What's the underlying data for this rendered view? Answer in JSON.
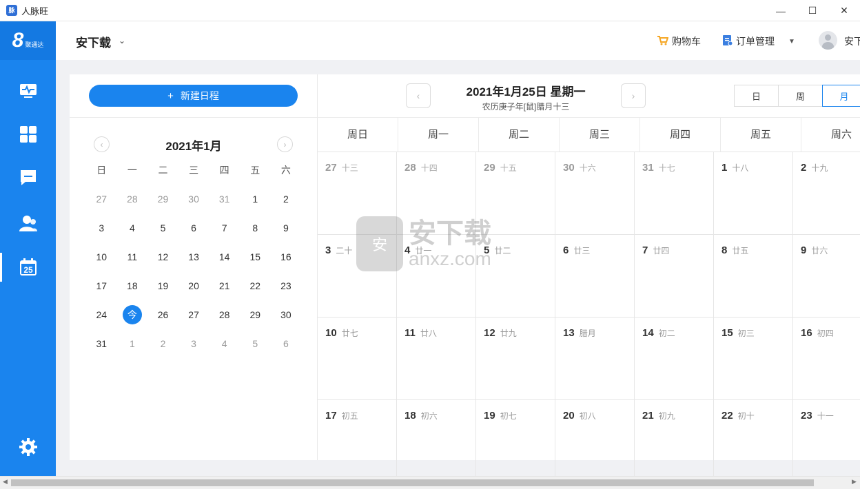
{
  "window": {
    "title": "人脉旺",
    "minimize": "—",
    "maximize": "☐",
    "close": "✕"
  },
  "logo": {
    "mark": "8",
    "text": "聚通达"
  },
  "header": {
    "user": "安下载",
    "cart": "购物车",
    "orders": "订单管理",
    "account": "安下载"
  },
  "sidebar": {
    "items": [
      {
        "name": "dashboard",
        "icon": "monitor-icon"
      },
      {
        "name": "apps",
        "icon": "grid-icon"
      },
      {
        "name": "messages",
        "icon": "chat-icon"
      },
      {
        "name": "contacts",
        "icon": "users-icon"
      },
      {
        "name": "calendar",
        "icon": "calendar-icon",
        "badge": "25",
        "active": true
      }
    ],
    "settings_icon": "gear-icon"
  },
  "left": {
    "new_button": "新建日程",
    "plus": "+",
    "mini_title": "2021年1月",
    "weekday_heads": [
      "日",
      "一",
      "二",
      "三",
      "四",
      "五",
      "六"
    ],
    "weeks": [
      [
        [
          "27",
          1
        ],
        [
          "28",
          1
        ],
        [
          "29",
          1
        ],
        [
          "30",
          1
        ],
        [
          "31",
          1
        ],
        [
          "1",
          0
        ],
        [
          "2",
          0
        ]
      ],
      [
        [
          "3",
          0
        ],
        [
          "4",
          0
        ],
        [
          "5",
          0
        ],
        [
          "6",
          0
        ],
        [
          "7",
          0
        ],
        [
          "8",
          0
        ],
        [
          "9",
          0
        ]
      ],
      [
        [
          "10",
          0
        ],
        [
          "11",
          0
        ],
        [
          "12",
          0
        ],
        [
          "13",
          0
        ],
        [
          "14",
          0
        ],
        [
          "15",
          0
        ],
        [
          "16",
          0
        ]
      ],
      [
        [
          "17",
          0
        ],
        [
          "18",
          0
        ],
        [
          "19",
          0
        ],
        [
          "20",
          0
        ],
        [
          "21",
          0
        ],
        [
          "22",
          0
        ],
        [
          "23",
          0
        ]
      ],
      [
        [
          "24",
          0
        ],
        [
          "今",
          2
        ],
        [
          "26",
          0
        ],
        [
          "27",
          0
        ],
        [
          "28",
          0
        ],
        [
          "29",
          0
        ],
        [
          "30",
          0
        ]
      ],
      [
        [
          "31",
          0
        ],
        [
          "1",
          1
        ],
        [
          "2",
          1
        ],
        [
          "3",
          1
        ],
        [
          "4",
          1
        ],
        [
          "5",
          1
        ],
        [
          "6",
          1
        ]
      ]
    ]
  },
  "right": {
    "date_title": "2021年1月25日 星期一",
    "lunar": "农历庚子年[鼠]腊月十三",
    "views": [
      "日",
      "周",
      "月"
    ],
    "active_view": "月",
    "week_heads": [
      "周日",
      "周一",
      "周二",
      "周三",
      "周四",
      "周五",
      "周六"
    ],
    "rows": [
      [
        [
          "27",
          "十三",
          1
        ],
        [
          "28",
          "十四",
          1
        ],
        [
          "29",
          "十五",
          1
        ],
        [
          "30",
          "十六",
          1
        ],
        [
          "31",
          "十七",
          1
        ],
        [
          "1",
          "十八",
          0
        ],
        [
          "2",
          "十九",
          0
        ]
      ],
      [
        [
          "3",
          "二十",
          0
        ],
        [
          "4",
          "廿一",
          0
        ],
        [
          "5",
          "廿二",
          0
        ],
        [
          "6",
          "廿三",
          0
        ],
        [
          "7",
          "廿四",
          0
        ],
        [
          "8",
          "廿五",
          0
        ],
        [
          "9",
          "廿六",
          0
        ]
      ],
      [
        [
          "10",
          "廿七",
          0
        ],
        [
          "11",
          "廿八",
          0
        ],
        [
          "12",
          "廿九",
          0
        ],
        [
          "13",
          "腊月",
          0
        ],
        [
          "14",
          "初二",
          0
        ],
        [
          "15",
          "初三",
          0
        ],
        [
          "16",
          "初四",
          0
        ]
      ],
      [
        [
          "17",
          "初五",
          0
        ],
        [
          "18",
          "初六",
          0
        ],
        [
          "19",
          "初七",
          0
        ],
        [
          "20",
          "初八",
          0
        ],
        [
          "21",
          "初九",
          0
        ],
        [
          "22",
          "初十",
          0
        ],
        [
          "23",
          "十一",
          0
        ]
      ]
    ]
  },
  "watermark": {
    "icon": "安",
    "title": "安下载",
    "domain": "anxz.com"
  },
  "colors": {
    "primary": "#1a84ee",
    "sidebar": "#1a84ee",
    "background": "#f0f1f4"
  }
}
